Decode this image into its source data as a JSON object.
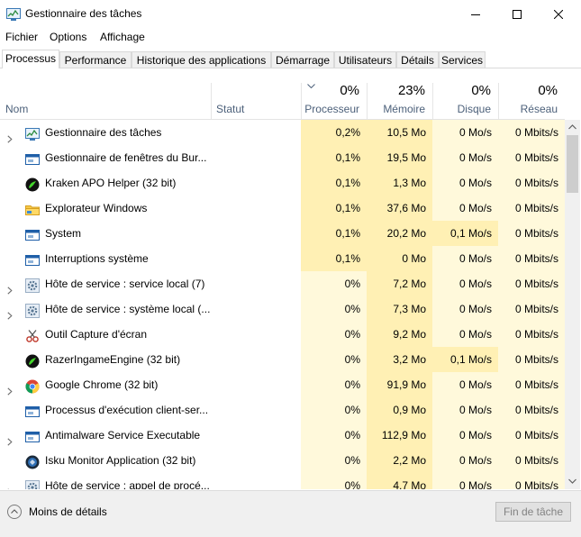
{
  "window": {
    "title": "Gestionnaire des tâches"
  },
  "menu": [
    "Fichier",
    "Options",
    "Affichage"
  ],
  "tabs": [
    "Processus",
    "Performance",
    "Historique des applications",
    "Démarrage",
    "Utilisateurs",
    "Détails",
    "Services"
  ],
  "header": {
    "name": "Nom",
    "status": "Statut",
    "cpu": {
      "pct": "0%",
      "label": "Processeur"
    },
    "memory": {
      "pct": "23%",
      "label": "Mémoire"
    },
    "disk": {
      "pct": "0%",
      "label": "Disque"
    },
    "network": {
      "pct": "0%",
      "label": "Réseau"
    }
  },
  "colors": {
    "heat_high": "#fff0b4",
    "heat_low": "#fff9db",
    "tab_border": "#d9d9d9"
  },
  "rows": [
    {
      "name": "Gestionnaire des tâches",
      "icon": "taskmgr-icon",
      "expand": true,
      "cpu": "0,2%",
      "mem": "10,5 Mo",
      "disk": "0 Mo/s",
      "net": "0 Mbits/s"
    },
    {
      "name": "Gestionnaire de fenêtres du Bur...",
      "icon": "window-app-icon",
      "expand": false,
      "cpu": "0,1%",
      "mem": "19,5 Mo",
      "disk": "0 Mo/s",
      "net": "0 Mbits/s"
    },
    {
      "name": "Kraken APO Helper (32 bit)",
      "icon": "razer-icon",
      "expand": false,
      "cpu": "0,1%",
      "mem": "1,3 Mo",
      "disk": "0 Mo/s",
      "net": "0 Mbits/s"
    },
    {
      "name": "Explorateur Windows",
      "icon": "folder-icon",
      "expand": false,
      "cpu": "0,1%",
      "mem": "37,6 Mo",
      "disk": "0 Mo/s",
      "net": "0 Mbits/s"
    },
    {
      "name": "System",
      "icon": "window-app-icon",
      "expand": false,
      "cpu": "0,1%",
      "mem": "20,2 Mo",
      "disk": "0,1 Mo/s",
      "net": "0 Mbits/s"
    },
    {
      "name": "Interruptions système",
      "icon": "window-app-icon",
      "expand": false,
      "cpu": "0,1%",
      "mem": "0 Mo",
      "disk": "0 Mo/s",
      "net": "0 Mbits/s"
    },
    {
      "name": "Hôte de service : service local (7)",
      "icon": "gear-icon",
      "expand": true,
      "cpu": "0%",
      "mem": "7,2 Mo",
      "disk": "0 Mo/s",
      "net": "0 Mbits/s"
    },
    {
      "name": "Hôte de service : système local (...",
      "icon": "gear-icon",
      "expand": true,
      "cpu": "0%",
      "mem": "7,3 Mo",
      "disk": "0 Mo/s",
      "net": "0 Mbits/s"
    },
    {
      "name": "Outil Capture d'écran",
      "icon": "snipping-icon",
      "expand": false,
      "cpu": "0%",
      "mem": "9,2 Mo",
      "disk": "0 Mo/s",
      "net": "0 Mbits/s"
    },
    {
      "name": "RazerIngameEngine (32 bit)",
      "icon": "razer-icon",
      "expand": false,
      "cpu": "0%",
      "mem": "3,2 Mo",
      "disk": "0,1 Mo/s",
      "net": "0 Mbits/s"
    },
    {
      "name": "Google Chrome (32 bit)",
      "icon": "chrome-icon",
      "expand": true,
      "cpu": "0%",
      "mem": "91,9 Mo",
      "disk": "0 Mo/s",
      "net": "0 Mbits/s"
    },
    {
      "name": "Processus d'exécution client-ser...",
      "icon": "window-app-icon",
      "expand": false,
      "cpu": "0%",
      "mem": "0,9 Mo",
      "disk": "0 Mo/s",
      "net": "0 Mbits/s"
    },
    {
      "name": "Antimalware Service Executable",
      "icon": "window-app-icon",
      "expand": true,
      "cpu": "0%",
      "mem": "112,9 Mo",
      "disk": "0 Mo/s",
      "net": "0 Mbits/s"
    },
    {
      "name": "Isku Monitor Application (32 bit)",
      "icon": "isku-icon",
      "expand": false,
      "cpu": "0%",
      "mem": "2,2 Mo",
      "disk": "0 Mo/s",
      "net": "0 Mbits/s"
    },
    {
      "name": "Hôte de service : appel de procé...",
      "icon": "gear-icon",
      "expand": true,
      "cpu": "0%",
      "mem": "4,7 Mo",
      "disk": "0 Mo/s",
      "net": "0 Mbits/s"
    }
  ],
  "footer": {
    "fewer_details": "Moins de détails",
    "end_task": "Fin de tâche"
  }
}
